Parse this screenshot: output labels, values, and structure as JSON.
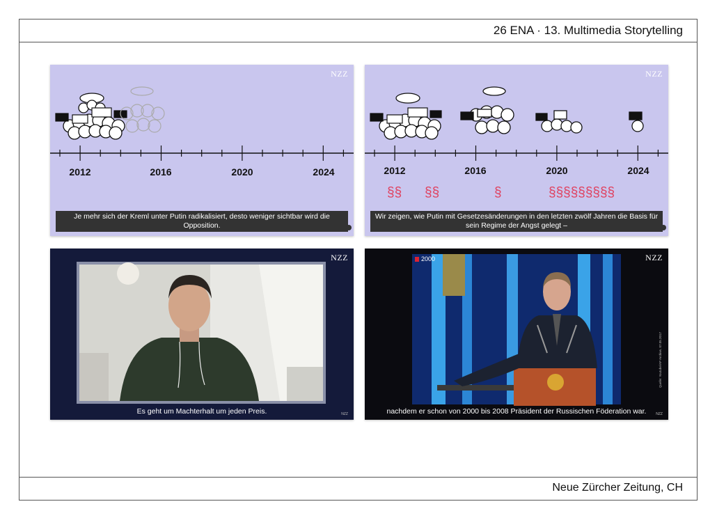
{
  "header": {
    "title": "26 ENA · 13. Multimedia Storytelling"
  },
  "footer": {
    "source": "Neue Zürcher Zeitung, CH"
  },
  "brand": "NZZ",
  "panels": [
    {
      "years": [
        "2012",
        "2016",
        "2020",
        "2024"
      ],
      "subtitle": "Je mehr sich der Kreml unter Putin radikalisiert, desto weniger sichtbar wird die Opposition."
    },
    {
      "years": [
        "2012",
        "2016",
        "2020",
        "2024"
      ],
      "paragraph_groups": [
        "§§",
        "§§",
        "§",
        "§§§§§§§§§"
      ],
      "subtitle": "Wir zeigen, wie Putin mit Gesetzesänderungen in den letzten zwölf Jahren die Basis für sein Regime der Angst gelegt –"
    },
    {
      "subtitle": "Es geht um Machterhalt um jeden Preis."
    },
    {
      "year_badge": "2000",
      "source_credit": "Quelle: Youtube/AP Archive, 07.05.2017",
      "subtitle": "nachdem er schon von 2000 bis 2008 Präsident der Russischen Föderation war."
    }
  ],
  "colors": {
    "panel_bg": "#c9c6ee",
    "accent": "#e0415f"
  }
}
